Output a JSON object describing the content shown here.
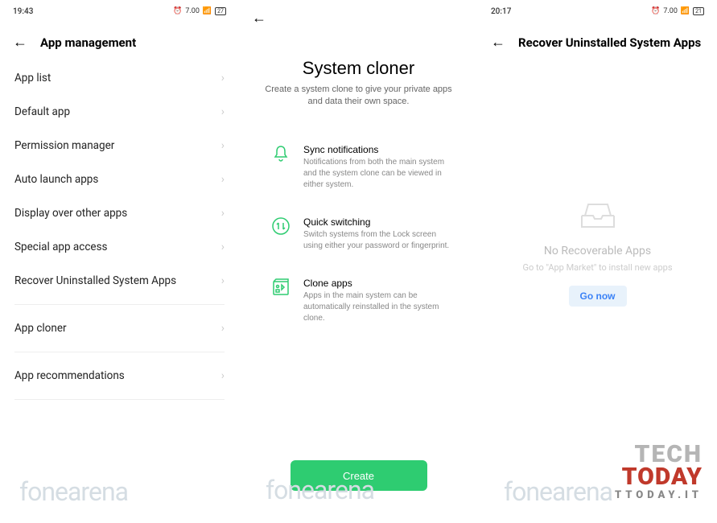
{
  "screen1": {
    "status": {
      "time": "19:43",
      "battery": "27"
    },
    "title": "App management",
    "items1": [
      "App list",
      "Default app",
      "Permission manager",
      "Auto launch apps",
      "Display over other apps",
      "Special app access",
      "Recover Uninstalled System Apps"
    ],
    "items2": [
      "App cloner"
    ],
    "items3": [
      "App recommendations"
    ]
  },
  "screen2": {
    "title": "System cloner",
    "subtitle": "Create a system clone to give your private apps and data their own space.",
    "features": [
      {
        "icon": "bell-icon",
        "title": "Sync notifications",
        "desc": "Notifications from both the main system and the system clone can be viewed in either system."
      },
      {
        "icon": "switch-icon",
        "title": "Quick switching",
        "desc": "Switch systems from the Lock screen using either your password or fingerprint."
      },
      {
        "icon": "apps-icon",
        "title": "Clone apps",
        "desc": "Apps in the main system can be automatically reinstalled in the system clone."
      }
    ],
    "create_label": "Create"
  },
  "screen3": {
    "status": {
      "time": "20:17",
      "battery": "21"
    },
    "title": "Recover Uninstalled System Apps",
    "empty_title": "No Recoverable Apps",
    "empty_sub": "Go to \"App Market\" to install new apps",
    "go_now": "Go now"
  },
  "watermark": "fonearena",
  "techtoday": {
    "l1": "TECH",
    "l2": "TODAY",
    "l3": "TTODAY.IT"
  }
}
